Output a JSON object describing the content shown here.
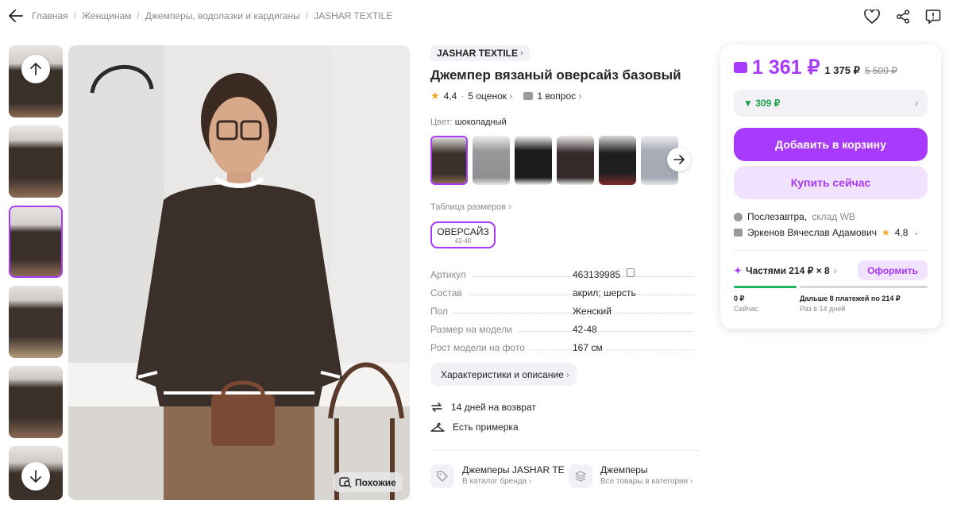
{
  "breadcrumbs": [
    "Главная",
    "Женщинам",
    "Джемперы, водолазки и кардиганы",
    "JASHAR TEXTILE"
  ],
  "product": {
    "brand": "JASHAR TEXTILE",
    "title": "Джемпер вязаный оверсайз базовый",
    "rating": "4,4",
    "reviews": "5 оценок",
    "questions": "1 вопрос",
    "color_label": "Цвет:",
    "color_value": "шоколадный",
    "size_table": "Таблица размеров",
    "size_name": "ОВЕРСАЙЗ",
    "size_range": "42-48",
    "similar": "Похожие"
  },
  "specs": [
    {
      "k": "Артикул",
      "v": "463139985"
    },
    {
      "k": "Состав",
      "v": "акрил; шерсть"
    },
    {
      "k": "Пол",
      "v": "Женский"
    },
    {
      "k": "Размер на модели",
      "v": "42-48"
    },
    {
      "k": "Рост модели на фото",
      "v": "167 см"
    }
  ],
  "char_button": "Характеристики и описание",
  "features": [
    "14 дней на возврат",
    "Есть примерка"
  ],
  "catalog": [
    {
      "t1": "Джемперы JASHAR TE",
      "t2": "В каталог бренда"
    },
    {
      "t1": "Джемперы",
      "t2": "Все товары в категории"
    }
  ],
  "buy": {
    "price": "1 361 ₽",
    "price_old": "1 375 ₽",
    "price_orig": "5 500 ₽",
    "bonus": "▼ 309 ₽",
    "cart": "Добавить в корзину",
    "buy_now": "Купить сейчас",
    "delivery": "Послезавтра,",
    "warehouse": "склад WB",
    "seller": "Эркенов Вячеслав Адамович",
    "seller_rating": "4,8",
    "parts": "Частями 214 ₽ × 8",
    "oform": "Оформить",
    "p1a": "0 ₽",
    "p1b": "Сейчас",
    "p2a": "Дальше 8 платежей по 214 ₽",
    "p2b": "Раз в 14 дней"
  },
  "colors": {
    "accent": "#a73afd",
    "accent_light": "#f1e2ff",
    "green": "#1b9e4a"
  }
}
